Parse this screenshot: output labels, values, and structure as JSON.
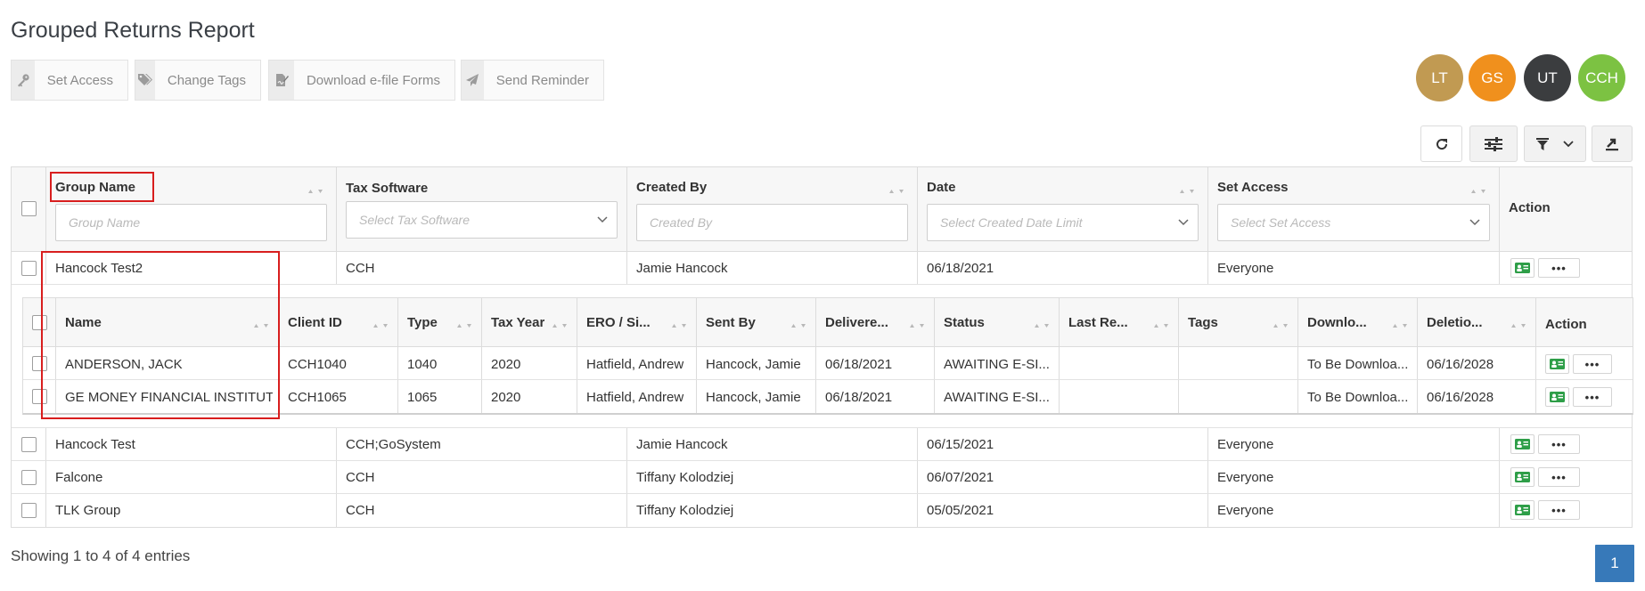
{
  "page": {
    "title": "Grouped Returns Report"
  },
  "toolbar": {
    "set_access": "Set Access",
    "change_tags": "Change Tags",
    "download_forms": "Download e-file Forms",
    "send_reminder": "Send Reminder"
  },
  "avatars": [
    {
      "initials": "LT",
      "color": "#c19a52"
    },
    {
      "initials": "GS",
      "color": "#f0901d"
    },
    {
      "initials": "UT",
      "color": "#3b3d3f"
    },
    {
      "initials": "CCH",
      "color": "#7cc242"
    }
  ],
  "table": {
    "headers": {
      "group_name": "Group Name",
      "tax_software": "Tax Software",
      "created_by": "Created By",
      "date": "Date",
      "set_access": "Set Access",
      "action": "Action"
    },
    "filters": {
      "group_name": "Group Name",
      "tax_software": "Select Tax Software",
      "created_by": "Created By",
      "date": "Select Created Date Limit",
      "set_access": "Select Set Access"
    },
    "rows": [
      {
        "group_name": "Hancock Test2",
        "tax_software": "CCH",
        "created_by": "Jamie Hancock",
        "date": "06/18/2021",
        "set_access": "Everyone"
      },
      {
        "group_name": "Hancock Test",
        "tax_software": "CCH;GoSystem",
        "created_by": "Jamie Hancock",
        "date": "06/15/2021",
        "set_access": "Everyone"
      },
      {
        "group_name": "Falcone",
        "tax_software": "CCH",
        "created_by": "Tiffany Kolodziej",
        "date": "06/07/2021",
        "set_access": "Everyone"
      },
      {
        "group_name": "TLK Group",
        "tax_software": "CCH",
        "created_by": "Tiffany Kolodziej",
        "date": "05/05/2021",
        "set_access": "Everyone"
      }
    ]
  },
  "nested": {
    "headers": [
      "Name",
      "Client ID",
      "Type",
      "Tax Year",
      "ERO / Si...",
      "Sent By",
      "Delivere...",
      "Status",
      "Last Re...",
      "Tags",
      "Downlo...",
      "Deletio...",
      "Action"
    ],
    "rows": [
      {
        "name": "ANDERSON, JACK",
        "client_id": "CCH1040",
        "type": "1040",
        "tax_year": "2020",
        "ero": "Hatfield, Andrew",
        "sent_by": "Hancock, Jamie",
        "delivered": "06/18/2021",
        "status": "AWAITING E-SI...",
        "last_reminder": "",
        "tags": "",
        "download": "To Be Downloa...",
        "deletion": "06/16/2028"
      },
      {
        "name": "GE MONEY FINANCIAL INSTITUT...",
        "client_id": "CCH1065",
        "type": "1065",
        "tax_year": "2020",
        "ero": "Hatfield, Andrew",
        "sent_by": "Hancock, Jamie",
        "delivered": "06/18/2021",
        "status": "AWAITING E-SI...",
        "last_reminder": "",
        "tags": "",
        "download": "To Be Downloa...",
        "deletion": "06/16/2028"
      }
    ]
  },
  "footer": {
    "info": "Showing 1 to 4 of 4 entries",
    "page": "1"
  },
  "colors": {
    "accent": "#3779b9",
    "highlight": "#d81e1e",
    "action_card": "#2e9e48"
  }
}
